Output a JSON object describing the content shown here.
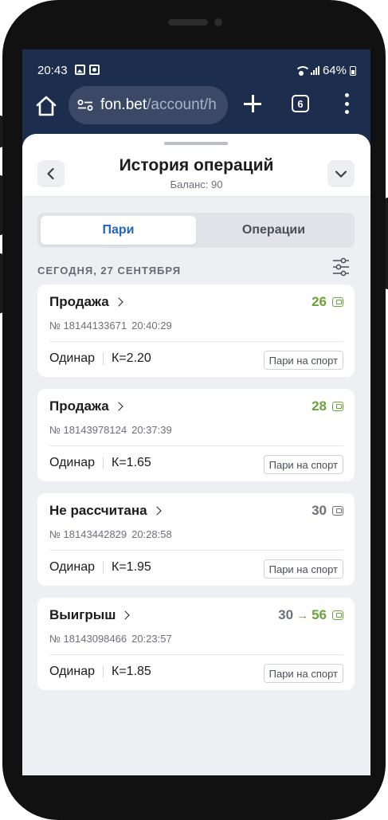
{
  "statusbar": {
    "time": "20:43",
    "battery": "64%"
  },
  "browser": {
    "url_host": "fon.bet",
    "url_path": "/account/h",
    "tab_count": "6"
  },
  "sheet": {
    "title": "История операций",
    "subtitle": "Баланс: 90"
  },
  "segments": {
    "active": "Пари",
    "inactive": "Операции"
  },
  "date_label": "СЕГОДНЯ, 27 СЕНТЯБРЯ",
  "cards": [
    {
      "status": "Продажа",
      "amount": "26",
      "amount_from": "",
      "number": "№ 18144133671",
      "time": "20:40:29",
      "type": "Одинар",
      "coef": "К=2.20",
      "tag": "Пари на спорт"
    },
    {
      "status": "Продажа",
      "amount": "28",
      "amount_from": "",
      "number": "№ 18143978124",
      "time": "20:37:39",
      "type": "Одинар",
      "coef": "К=1.65",
      "tag": "Пари на спорт"
    },
    {
      "status": "Не рассчитана",
      "amount": "30",
      "amount_from": "",
      "number": "№ 18143442829",
      "time": "20:28:58",
      "type": "Одинар",
      "coef": "К=1.95",
      "tag": "Пари на спорт"
    },
    {
      "status": "Выигрыш",
      "amount": "56",
      "amount_from": "30",
      "arrow": "→",
      "number": "№ 18143098466",
      "time": "20:23:57",
      "type": "Одинар",
      "coef": "К=1.85",
      "tag": "Пари на спорт"
    }
  ],
  "colors": {
    "accent": "#1f64c8",
    "win_green": "#6aa33a",
    "browser_bar": "#1d2d4d"
  }
}
